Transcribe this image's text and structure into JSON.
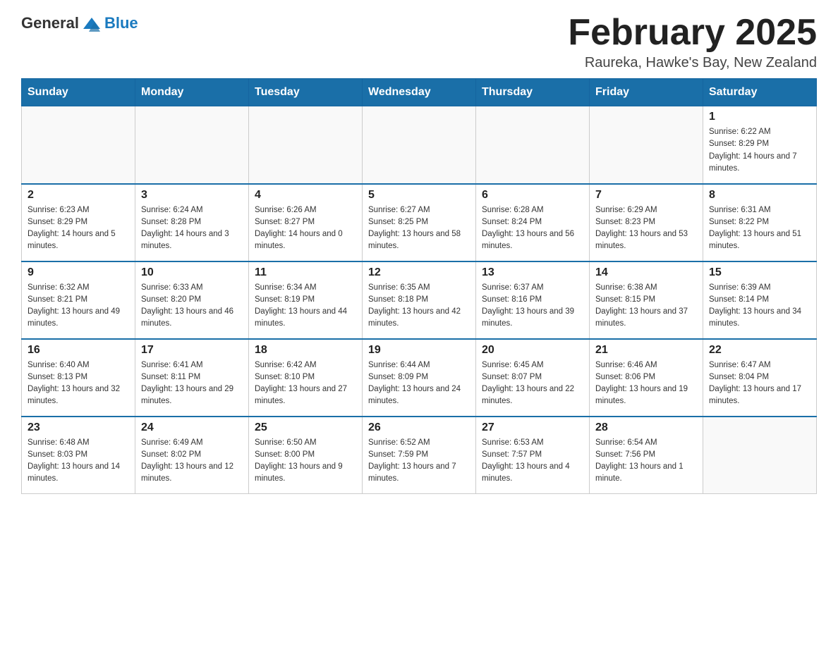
{
  "logo": {
    "text_general": "General",
    "text_blue": "Blue"
  },
  "title": "February 2025",
  "location": "Raureka, Hawke's Bay, New Zealand",
  "days_of_week": [
    "Sunday",
    "Monday",
    "Tuesday",
    "Wednesday",
    "Thursday",
    "Friday",
    "Saturday"
  ],
  "weeks": [
    [
      {
        "day": "",
        "info": ""
      },
      {
        "day": "",
        "info": ""
      },
      {
        "day": "",
        "info": ""
      },
      {
        "day": "",
        "info": ""
      },
      {
        "day": "",
        "info": ""
      },
      {
        "day": "",
        "info": ""
      },
      {
        "day": "1",
        "info": "Sunrise: 6:22 AM\nSunset: 8:29 PM\nDaylight: 14 hours and 7 minutes."
      }
    ],
    [
      {
        "day": "2",
        "info": "Sunrise: 6:23 AM\nSunset: 8:29 PM\nDaylight: 14 hours and 5 minutes."
      },
      {
        "day": "3",
        "info": "Sunrise: 6:24 AM\nSunset: 8:28 PM\nDaylight: 14 hours and 3 minutes."
      },
      {
        "day": "4",
        "info": "Sunrise: 6:26 AM\nSunset: 8:27 PM\nDaylight: 14 hours and 0 minutes."
      },
      {
        "day": "5",
        "info": "Sunrise: 6:27 AM\nSunset: 8:25 PM\nDaylight: 13 hours and 58 minutes."
      },
      {
        "day": "6",
        "info": "Sunrise: 6:28 AM\nSunset: 8:24 PM\nDaylight: 13 hours and 56 minutes."
      },
      {
        "day": "7",
        "info": "Sunrise: 6:29 AM\nSunset: 8:23 PM\nDaylight: 13 hours and 53 minutes."
      },
      {
        "day": "8",
        "info": "Sunrise: 6:31 AM\nSunset: 8:22 PM\nDaylight: 13 hours and 51 minutes."
      }
    ],
    [
      {
        "day": "9",
        "info": "Sunrise: 6:32 AM\nSunset: 8:21 PM\nDaylight: 13 hours and 49 minutes."
      },
      {
        "day": "10",
        "info": "Sunrise: 6:33 AM\nSunset: 8:20 PM\nDaylight: 13 hours and 46 minutes."
      },
      {
        "day": "11",
        "info": "Sunrise: 6:34 AM\nSunset: 8:19 PM\nDaylight: 13 hours and 44 minutes."
      },
      {
        "day": "12",
        "info": "Sunrise: 6:35 AM\nSunset: 8:18 PM\nDaylight: 13 hours and 42 minutes."
      },
      {
        "day": "13",
        "info": "Sunrise: 6:37 AM\nSunset: 8:16 PM\nDaylight: 13 hours and 39 minutes."
      },
      {
        "day": "14",
        "info": "Sunrise: 6:38 AM\nSunset: 8:15 PM\nDaylight: 13 hours and 37 minutes."
      },
      {
        "day": "15",
        "info": "Sunrise: 6:39 AM\nSunset: 8:14 PM\nDaylight: 13 hours and 34 minutes."
      }
    ],
    [
      {
        "day": "16",
        "info": "Sunrise: 6:40 AM\nSunset: 8:13 PM\nDaylight: 13 hours and 32 minutes."
      },
      {
        "day": "17",
        "info": "Sunrise: 6:41 AM\nSunset: 8:11 PM\nDaylight: 13 hours and 29 minutes."
      },
      {
        "day": "18",
        "info": "Sunrise: 6:42 AM\nSunset: 8:10 PM\nDaylight: 13 hours and 27 minutes."
      },
      {
        "day": "19",
        "info": "Sunrise: 6:44 AM\nSunset: 8:09 PM\nDaylight: 13 hours and 24 minutes."
      },
      {
        "day": "20",
        "info": "Sunrise: 6:45 AM\nSunset: 8:07 PM\nDaylight: 13 hours and 22 minutes."
      },
      {
        "day": "21",
        "info": "Sunrise: 6:46 AM\nSunset: 8:06 PM\nDaylight: 13 hours and 19 minutes."
      },
      {
        "day": "22",
        "info": "Sunrise: 6:47 AM\nSunset: 8:04 PM\nDaylight: 13 hours and 17 minutes."
      }
    ],
    [
      {
        "day": "23",
        "info": "Sunrise: 6:48 AM\nSunset: 8:03 PM\nDaylight: 13 hours and 14 minutes."
      },
      {
        "day": "24",
        "info": "Sunrise: 6:49 AM\nSunset: 8:02 PM\nDaylight: 13 hours and 12 minutes."
      },
      {
        "day": "25",
        "info": "Sunrise: 6:50 AM\nSunset: 8:00 PM\nDaylight: 13 hours and 9 minutes."
      },
      {
        "day": "26",
        "info": "Sunrise: 6:52 AM\nSunset: 7:59 PM\nDaylight: 13 hours and 7 minutes."
      },
      {
        "day": "27",
        "info": "Sunrise: 6:53 AM\nSunset: 7:57 PM\nDaylight: 13 hours and 4 minutes."
      },
      {
        "day": "28",
        "info": "Sunrise: 6:54 AM\nSunset: 7:56 PM\nDaylight: 13 hours and 1 minute."
      },
      {
        "day": "",
        "info": ""
      }
    ]
  ]
}
